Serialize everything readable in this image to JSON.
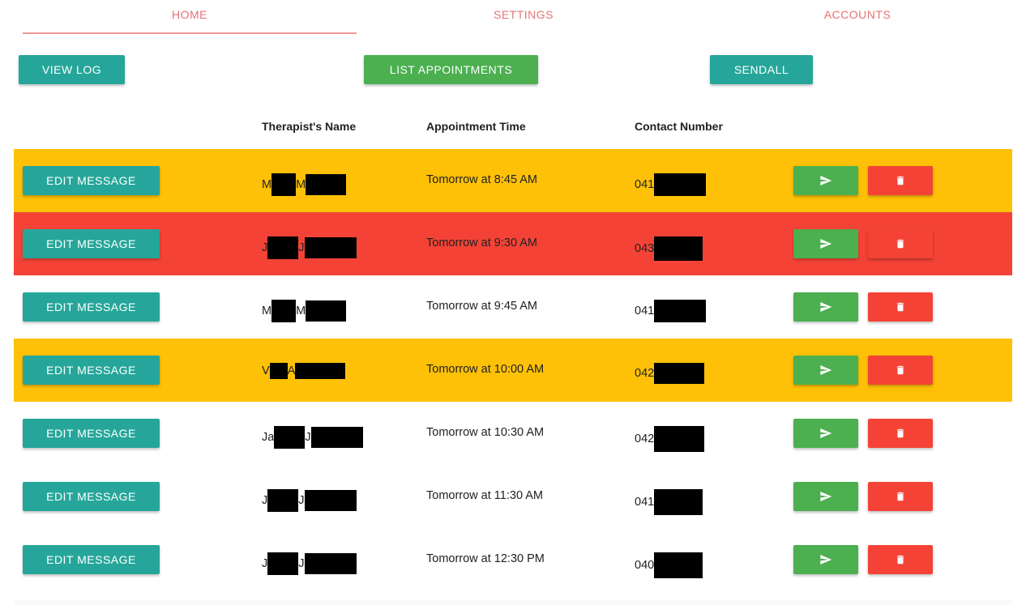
{
  "tabs": [
    {
      "label": "HOME",
      "active": true
    },
    {
      "label": "SETTINGS",
      "active": false
    },
    {
      "label": "ACCOUNTS",
      "active": false
    }
  ],
  "toolbar": {
    "view_log": "VIEW LOG",
    "list_appointments": "LIST APPOINTMENTS",
    "sendall": "SENDALL"
  },
  "table": {
    "headers": {
      "name": "Therapist's Name",
      "time": "Appointment Time",
      "contact": "Contact Number"
    },
    "edit_label": "EDIT MESSAGE",
    "rows": [
      {
        "status": "amber",
        "name_a": "M",
        "name_b": "M",
        "time": "Tomorrow at 8:45 AM",
        "contact": "041"
      },
      {
        "status": "red",
        "name_a": "J",
        "name_b": "J",
        "time": "Tomorrow at 9:30 AM",
        "contact": "043"
      },
      {
        "status": "white",
        "name_a": "M",
        "name_b": "M",
        "time": "Tomorrow at 9:45 AM",
        "contact": "041"
      },
      {
        "status": "amber",
        "name_a": "V",
        "name_b": "A",
        "time": "Tomorrow at 10:00 AM",
        "contact": "042"
      },
      {
        "status": "white",
        "name_a": "Ja",
        "name_b": "J",
        "time": "Tomorrow at 10:30 AM",
        "contact": "042"
      },
      {
        "status": "white",
        "name_a": "J",
        "name_b": "J",
        "time": "Tomorrow at 11:30 AM",
        "contact": "041"
      },
      {
        "status": "white",
        "name_a": "J",
        "name_b": "J",
        "time": "Tomorrow at 12:30 PM",
        "contact": "040"
      }
    ]
  },
  "icons": {
    "send": "send-icon",
    "delete": "trash-icon"
  },
  "colors": {
    "teal": "#26a69a",
    "green": "#4caf50",
    "red": "#f44336",
    "amber": "#ffc107",
    "tab_text": "#e57373"
  }
}
